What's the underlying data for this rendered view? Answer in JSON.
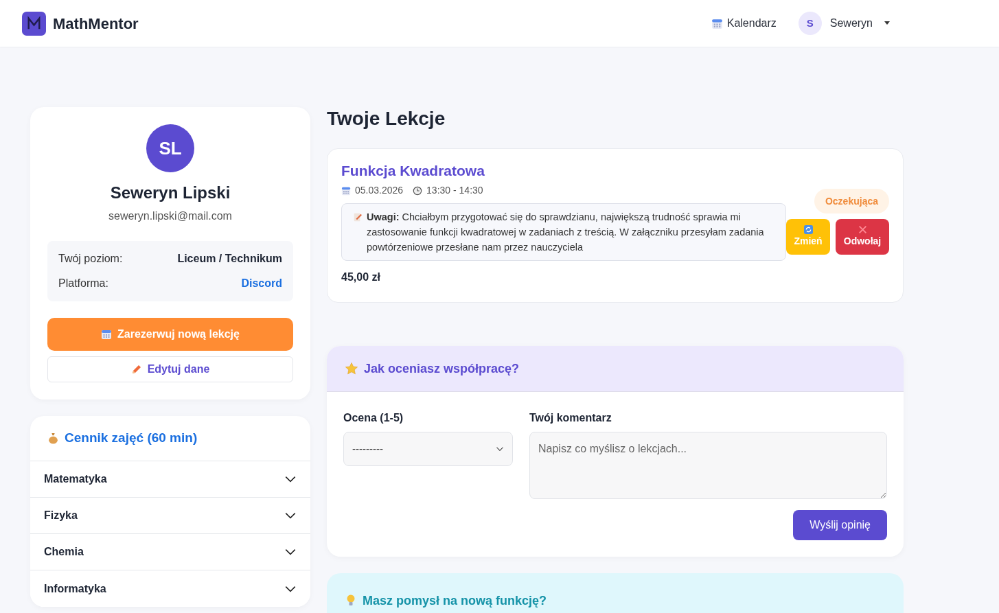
{
  "navbar": {
    "brand": "MathMentor",
    "calendar_link": "Kalendarz",
    "user": {
      "initial": "S",
      "name": "Seweryn"
    }
  },
  "profile": {
    "initials": "SL",
    "name": "Seweryn Lipski",
    "email": "seweryn.lipski@mail.com",
    "details": [
      {
        "label": "Twój poziom:",
        "value": "Liceum / Technikum",
        "kind": "text"
      },
      {
        "label": "Platforma:",
        "value": "Discord",
        "kind": "link"
      }
    ],
    "primary_button": "Zarezerwuj nową lekcję",
    "secondary_button": "Edytuj dane"
  },
  "pricing": {
    "title": "Cennik zajęć (60 min)",
    "items": [
      {
        "label": "Matematyka",
        "expanded": false
      },
      {
        "label": "Fizyka",
        "expanded": false
      },
      {
        "label": "Chemia",
        "expanded": false
      },
      {
        "label": "Informatyka",
        "expanded": false
      }
    ]
  },
  "lessons": {
    "heading": "Twoje Lekcje",
    "items": [
      {
        "title": "Funkcja Kwadratowa",
        "date": "05.03.2026",
        "time": "13:30 - 14:30",
        "notes": "**Uwagi:** Chciałbym przygotować się do sprawdzianu, największą trudność sprawia mi zastosowanie funkcji kwadratowej w zadaniach z treścią. W załączniku przesyłam zadania powtórzeniowe przesłane nam przez nauczyciela",
        "price": "45,00 zł",
        "status": "Oczekująca",
        "change_button": "Zmień",
        "cancel_button": "Odwołaj"
      }
    ]
  },
  "rating": {
    "title": "Jak oceniasz współpracę?",
    "score_label": "Ocena (1-5)",
    "score_value": "---------",
    "comment_label": "Twój komentarz",
    "comment_placeholder": "Napisz co myślisz o lekcjach...",
    "submit": "Wyślij opinię"
  },
  "idea": {
    "title": "Masz pomysł na nową funkcję?"
  }
}
